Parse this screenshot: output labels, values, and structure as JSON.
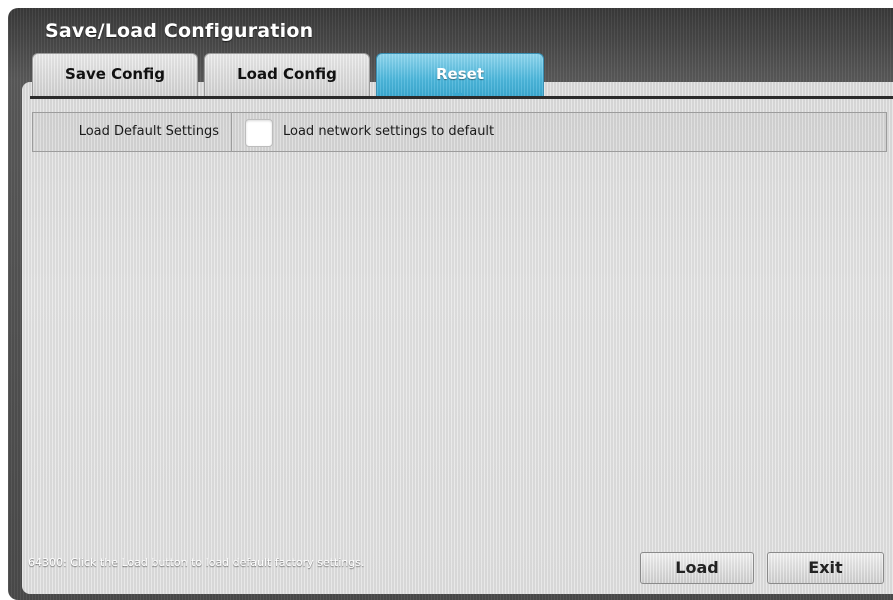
{
  "window": {
    "title": "Save/Load Configuration"
  },
  "tabs": [
    {
      "label": "Save Config",
      "active": false
    },
    {
      "label": "Load Config",
      "active": false
    },
    {
      "label": "Reset",
      "active": true
    }
  ],
  "reset_panel": {
    "row_label": "Load Default Settings",
    "checkbox_label": "Load network settings to default",
    "checkbox_checked": false
  },
  "status": {
    "message": "64300: Click the Load button to load default factory settings."
  },
  "buttons": {
    "load_label": "Load",
    "exit_label": "Exit"
  },
  "colors": {
    "active_tab": "#4cb7dc",
    "window_bg": "#4b4b4b",
    "panel_bg": "#dcdcdc"
  }
}
